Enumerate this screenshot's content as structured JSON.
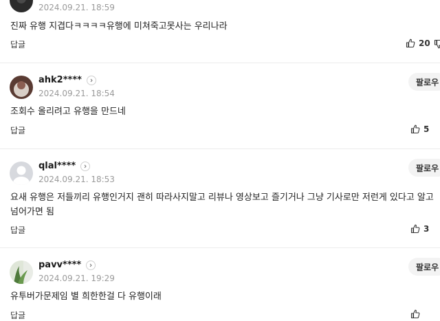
{
  "comments": [
    {
      "author": "",
      "date": "2024.09.21. 18:59",
      "follow_label": "",
      "text": "진짜 유행 지겹다ㅋㅋㅋㅋ유행에 미쳐죽고못사는 우리나라",
      "reply_label": "답글",
      "likes": "20",
      "avatar_icon": "profile-photo-dark"
    },
    {
      "author": "ahk2****",
      "date": "2024.09.21. 18:54",
      "follow_label": "팔로우",
      "text": "조회수 올리려고 유행을 만드네",
      "reply_label": "답글",
      "likes": "5",
      "avatar_icon": "profile-photo"
    },
    {
      "author": "qlal****",
      "date": "2024.09.21. 18:53",
      "follow_label": "팔로우",
      "text": "요새 유행은 저들끼리 유행인거지 괜히 따라사지말고 리뷰나 영상보고 즐기거나 그냥 기사로만 저런게 있다고 알고 넘어가면 됨",
      "reply_label": "답글",
      "likes": "3",
      "avatar_icon": "default-avatar"
    },
    {
      "author": "pavv****",
      "date": "2024.09.21. 19:29",
      "follow_label": "팔로우",
      "text": "유투버가문제임 별 희한한걸 다 유행이래",
      "reply_label": "답글",
      "likes": "",
      "avatar_icon": "profile-photo-plant"
    }
  ],
  "colors": {
    "date": "#9a9a9a",
    "divider": "#ececec",
    "follow_bg": "#f3f3f3",
    "default_avatar": "#d7d9de"
  }
}
